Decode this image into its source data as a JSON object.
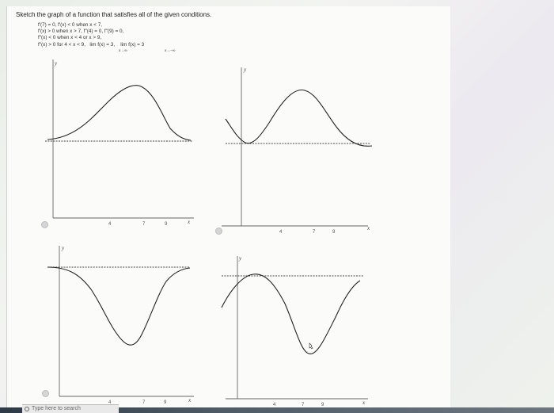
{
  "prompt": "Sketch the graph of a function that satisfies all of the given conditions.",
  "conditions": {
    "line1": "f′(7) = 0,   f′(x) < 0 when x < 7,",
    "line2": "f′(x) > 0 when x > 7,   f″(4) = 0,   f″(9) = 0,",
    "line3": "f″(x) < 0 when x < 4 or x > 9,",
    "line4_a": "f″(x) > 0 for 4 < x < 9,",
    "lim1": "lim f(x) = 3,",
    "lim1_sub": "x→∞",
    "lim2": "lim f(x) = 3",
    "lim2_sub": "x→−∞"
  },
  "axis": {
    "y": "y",
    "x": "x"
  },
  "ticks": [
    "4",
    "7",
    "9"
  ],
  "search": {
    "placeholder": "Type here to search"
  }
}
